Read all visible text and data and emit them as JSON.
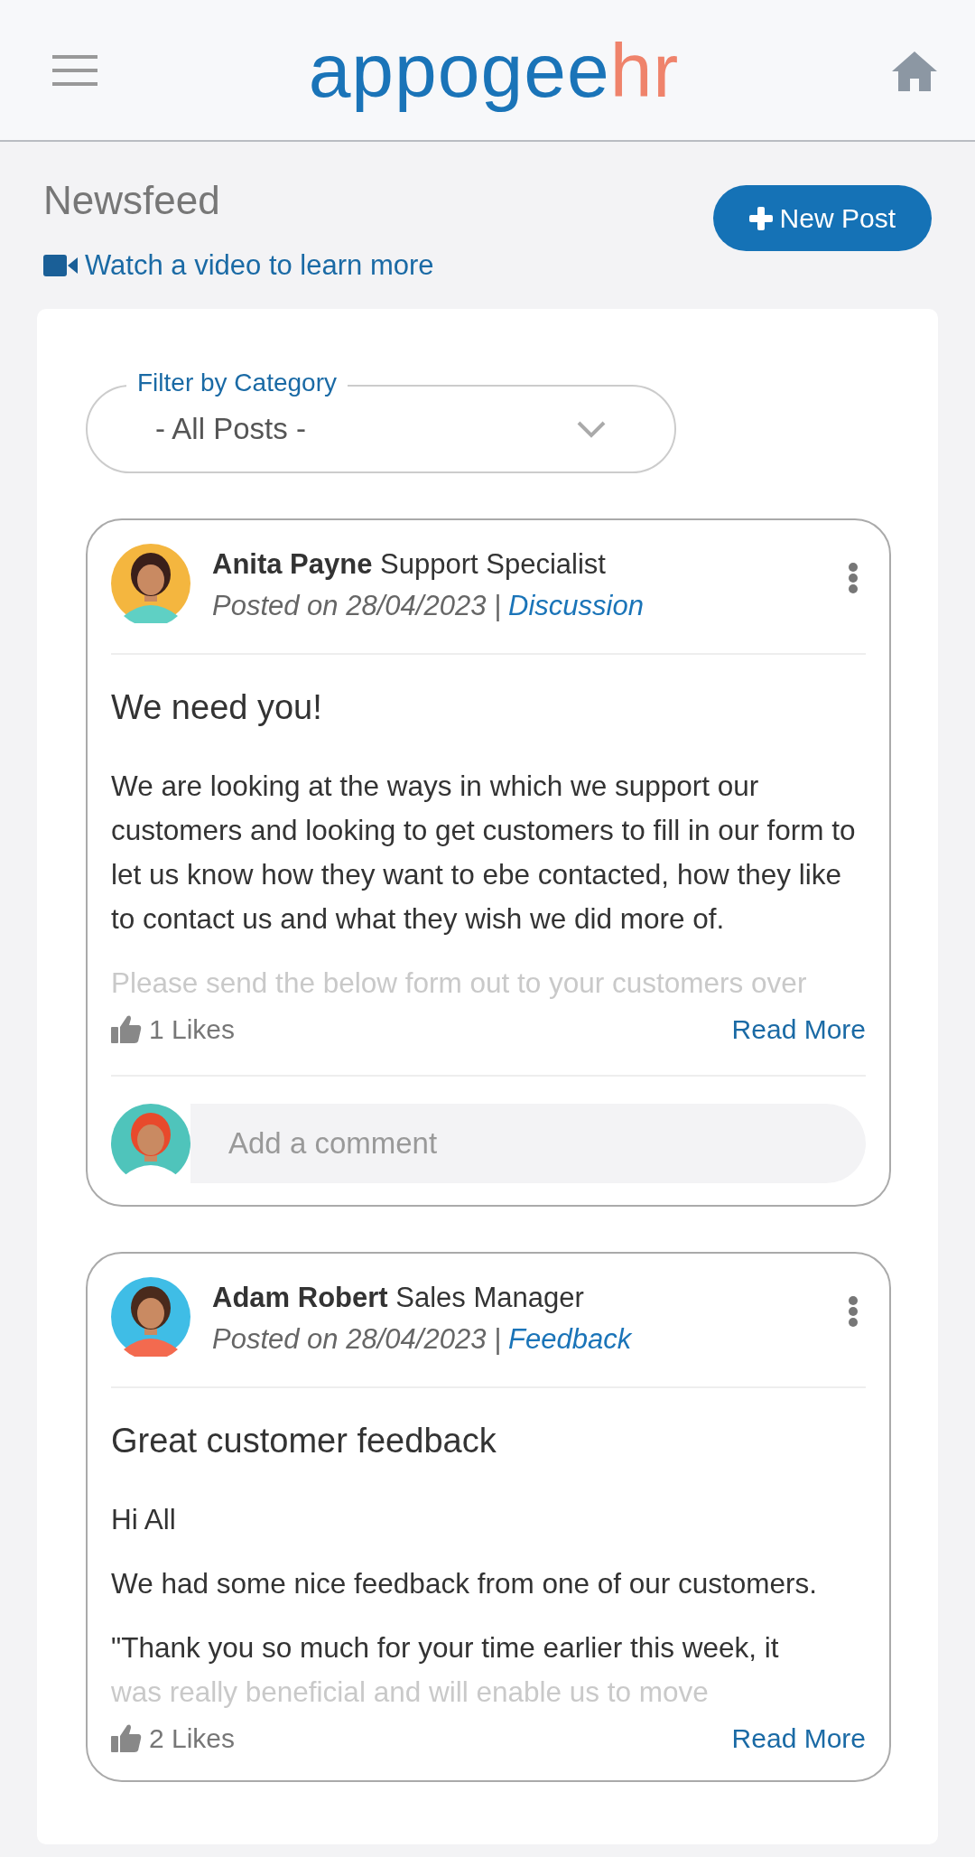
{
  "header": {
    "logo": [
      {
        "text": "appogee",
        "kind": "primary"
      },
      {
        "text": "hr",
        "kind": "accent"
      }
    ]
  },
  "page": {
    "title": "Newsfeed",
    "video_link": "Watch a video to learn more",
    "new_post_button": "New Post"
  },
  "filter": {
    "label": "Filter by Category",
    "value": "- All Posts -"
  },
  "posts": [
    {
      "author": "Anita Payne",
      "role": "Support Specialist",
      "posted": "Posted on 28/04/2023 |",
      "category": "Discussion",
      "title": "We need you!",
      "paragraphs": [
        [
          {
            "text": "We are looking at the ways in which we support our customers and looking to get customers to fill in our form to let us know how they want to ebe contacted, how they like to contact us and what they wish we did more of.",
            "faded": false
          }
        ],
        [
          {
            "text": "Please send the below form out to your customers over",
            "faded": true
          }
        ]
      ],
      "likes": "1 Likes",
      "read_more": "Read More",
      "comment_placeholder": "Add a comment"
    },
    {
      "author": "Adam Robert",
      "role": "Sales Manager",
      "posted": "Posted on 28/04/2023 |",
      "category": "Feedback",
      "title": "Great customer feedback",
      "paragraphs": [
        [
          {
            "text": "Hi All",
            "faded": false
          }
        ],
        [
          {
            "text": "We had some nice feedback from one of our customers.",
            "faded": false
          }
        ],
        [
          {
            "text": "\"Thank you so much for your time earlier this week, it",
            "faded": false
          },
          {
            "text": "was really beneficial and will enable us to move",
            "faded": true
          }
        ]
      ],
      "likes": "2 Likes",
      "read_more": "Read More"
    }
  ]
}
